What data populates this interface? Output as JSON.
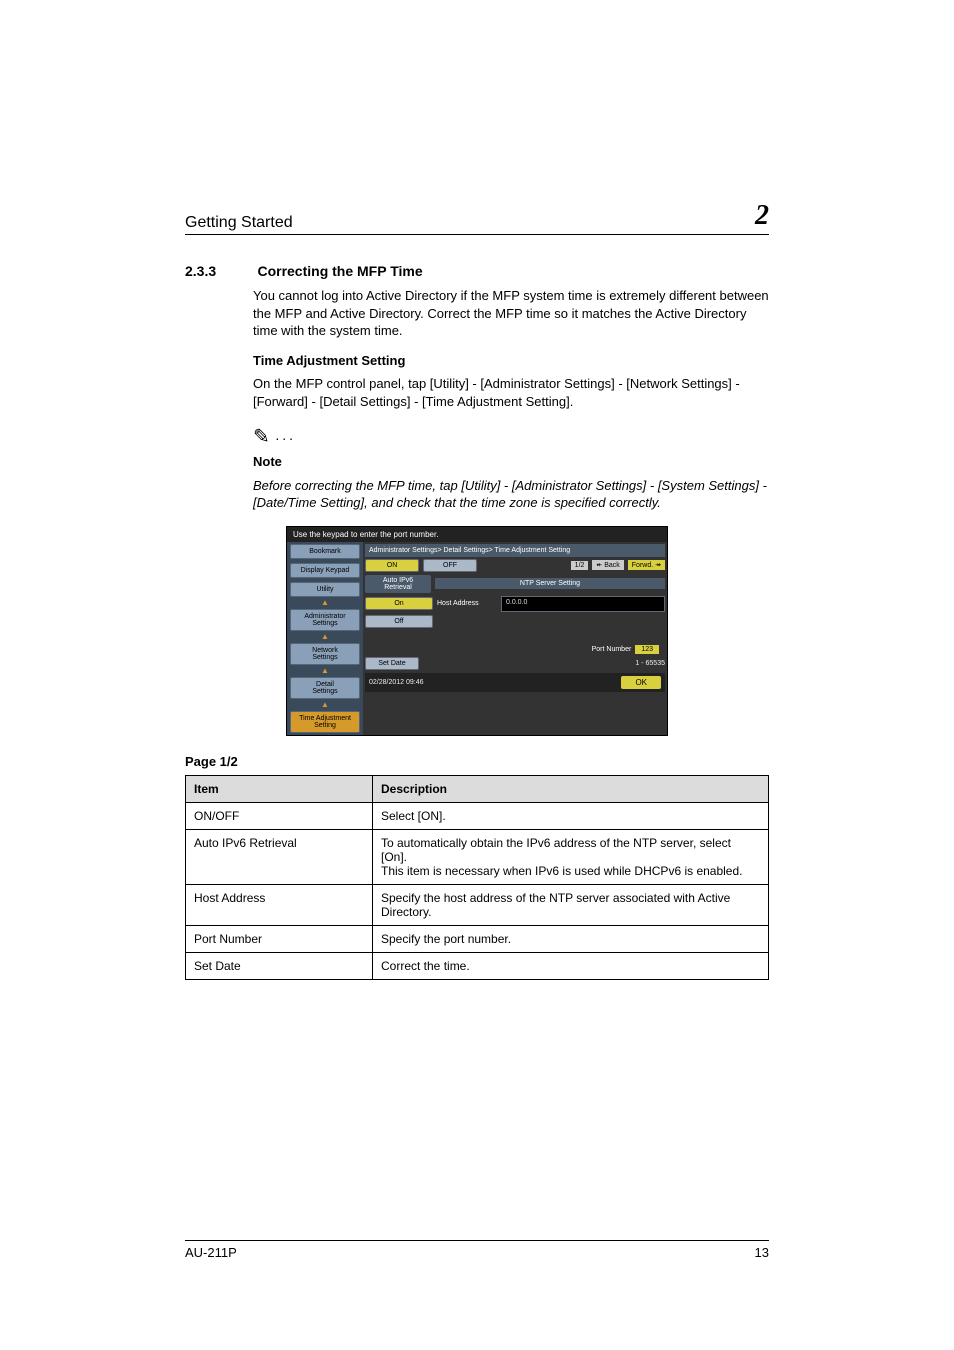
{
  "header": {
    "left": "Getting Started",
    "right": "2"
  },
  "section": {
    "number": "2.3.3",
    "title": "Correcting the MFP Time"
  },
  "intro": "You cannot log into Active Directory if the MFP system time is extremely different between the MFP and Active Directory. Correct the MFP time so it matches the Active Directory time with the system time.",
  "subheading": "Time Adjustment Setting",
  "instruction": "On the MFP control panel, tap [Utility] - [Administrator Settings] - [Network Settings] - [Forward] - [Detail Settings] - [Time Adjustment Setting].",
  "note": {
    "label": "Note",
    "text": "Before correcting the MFP time, tap [Utility] - [Administrator Settings] - [System Settings] - [Date/Time Setting], and check that the time zone is specified correctly."
  },
  "mfp": {
    "top_hint": "Use the keypad to enter the port number.",
    "sidebar": {
      "bookmark": "Bookmark",
      "display_keypad": "Display Keypad",
      "utility": "Utility",
      "admin": "Administrator\nSettings",
      "network": "Network\nSettings",
      "detail": "Detail\nSettings",
      "time_adj": "Time Adjustment\nSetting"
    },
    "breadcrumb": "Administrator Settings> Detail Settings> Time Adjustment Setting",
    "toggle": {
      "on": "ON",
      "off": "OFF"
    },
    "pager": {
      "page": "1/2",
      "back": "Back",
      "forwd": "Forwd."
    },
    "auto_ipv6_label": "Auto IPv6\nRetrieval",
    "auto_ipv6_on": "On",
    "auto_ipv6_off": "Off",
    "ntp_section": "NTP Server Setting",
    "host_label": "Host Address",
    "host_value": "0.0.0.0",
    "port_label": "Port Number",
    "port_value": "123",
    "port_range": "1 - 65535",
    "set_date": "Set Date",
    "datetime": "02/28/2012  09:46",
    "ok": "OK"
  },
  "page_label": "Page 1/2",
  "table": {
    "head": {
      "item": "Item",
      "desc": "Description"
    },
    "rows": [
      {
        "item": "ON/OFF",
        "desc": "Select [ON]."
      },
      {
        "item": "Auto IPv6 Retrieval",
        "desc": "To automatically obtain the IPv6 address of the NTP server, select [On].\nThis item is necessary when IPv6 is used while DHCPv6 is enabled."
      },
      {
        "item": "Host Address",
        "desc": "Specify the host address of the NTP server associated with Active Directory."
      },
      {
        "item": "Port Number",
        "desc": "Specify the port number."
      },
      {
        "item": "Set Date",
        "desc": "Correct the time."
      }
    ]
  },
  "footer": {
    "left": "AU-211P",
    "right": "13"
  }
}
